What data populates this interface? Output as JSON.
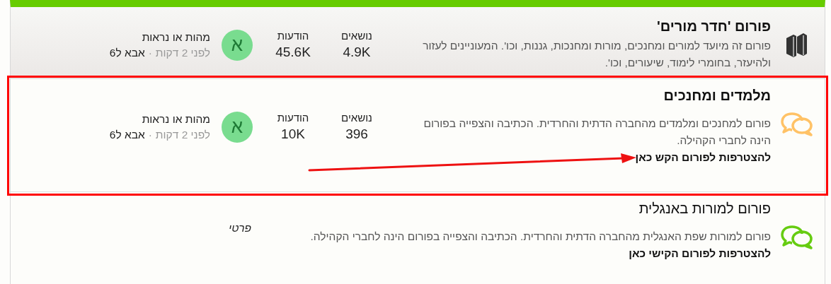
{
  "forums": [
    {
      "kind": "category",
      "title": "פורום 'חדר מורים'",
      "unread": true,
      "highlighted": false,
      "description": "פורום זה מיועד למורים ומחנכים, מורות ומחנכות, גננות, וכו'. המעוניינים לעזור ולהיעזר, בחומרי לימוד, שיעורים, וכו'.",
      "stats": [
        {
          "label": "נושאים",
          "value": "4.9K"
        },
        {
          "label": "הודעות",
          "value": "45.6K"
        }
      ],
      "last_post": {
        "avatar": "א",
        "title": "מהות או נראות",
        "time": "לפני 2 דקות",
        "separator": "·",
        "author": "אבא ל6"
      }
    },
    {
      "kind": "forum",
      "color": "#ffc266",
      "title": "מלמדים ומחנכים",
      "unread": true,
      "highlighted": true,
      "description": "פורום למחנכים ומלמדים מהחברה הדתית והחרדית. הכתיבה והצפייה בפורום הינה לחברי הקהילה.",
      "join_link": "להצטרפות לפורום הקש כאן",
      "stats": [
        {
          "label": "נושאים",
          "value": "396"
        },
        {
          "label": "הודעות",
          "value": "10K"
        }
      ],
      "last_post": {
        "avatar": "א",
        "title": "מהות או נראות",
        "time": "לפני 2 דקות",
        "separator": "·",
        "author": "אבא ל6"
      }
    },
    {
      "kind": "forum",
      "color": "#66cc11",
      "title": "פורום למורות באנגלית",
      "unread": false,
      "highlighted": false,
      "description": "פורום למורות שפת האנגלית מהחברה הדתית והחרדית. הכתיבה והצפייה בפורום הינה לחברי הקהילה.",
      "join_link": "להצטרפות לפורום הקישי כאן",
      "private_label": "פרטי"
    }
  ]
}
